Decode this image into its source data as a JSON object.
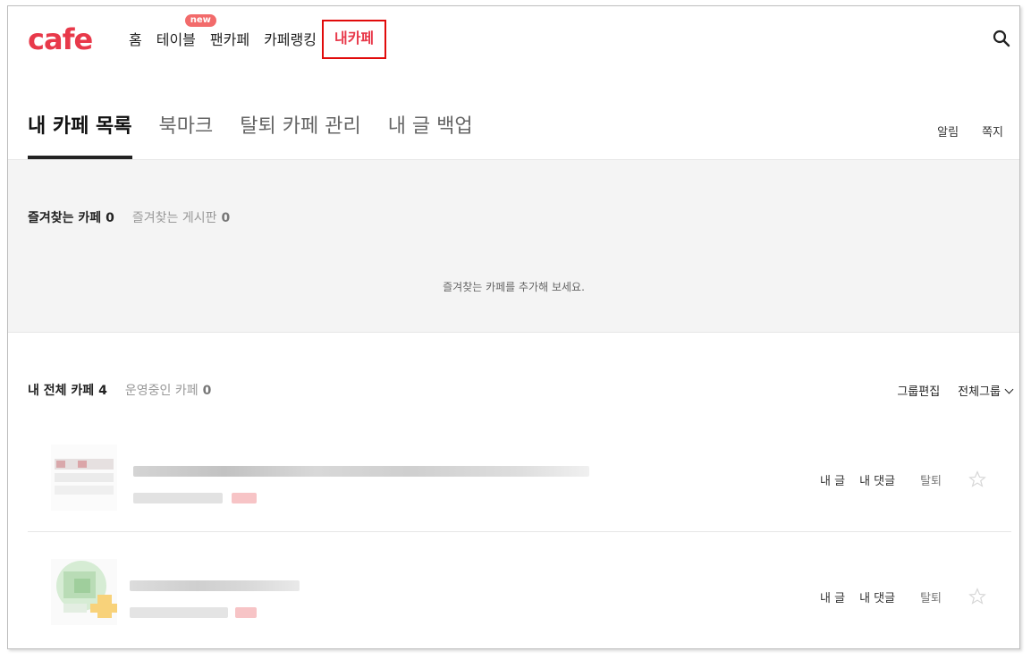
{
  "logo": "cafe",
  "gnb": [
    {
      "label": "홈"
    },
    {
      "label": "테이블",
      "badge": "new"
    },
    {
      "label": "팬카페"
    },
    {
      "label": "카페랭킹"
    },
    {
      "label": "내카페",
      "active": true
    }
  ],
  "subtabs": [
    {
      "label": "내 카페 목록",
      "active": true
    },
    {
      "label": "북마크"
    },
    {
      "label": "탈퇴 카페 관리"
    },
    {
      "label": "내 글 백업"
    }
  ],
  "sub_right": {
    "notice": "알림",
    "message": "쪽지"
  },
  "favorites": {
    "cafe_label": "즐겨찾는 카페",
    "cafe_count": "0",
    "board_label": "즐겨찾는 게시판",
    "board_count": "0",
    "empty_text": "즐겨찾는 카페를 추가해 보세요."
  },
  "all_cafes": {
    "label": "내 전체 카페",
    "count": "4",
    "managing_label": "운영중인 카페",
    "managing_count": "0",
    "edit_group": "그룹편집",
    "group_filter": "전체그룹"
  },
  "row_actions": {
    "my_posts": "내 글",
    "my_comments": "내 댓글",
    "quit": "탈퇴"
  },
  "colors": {
    "brand": "#e8394a",
    "highlight_box": "#e10b0b",
    "band_bg": "#f4f4f4"
  }
}
